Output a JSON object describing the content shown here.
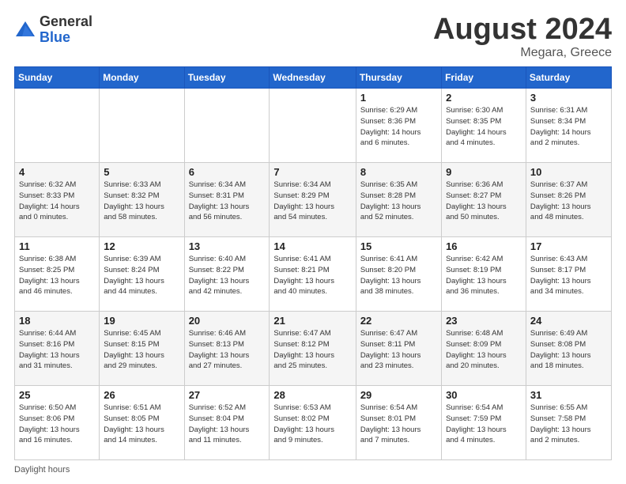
{
  "header": {
    "logo_general": "General",
    "logo_blue": "Blue",
    "title": "August 2024",
    "location": "Megara, Greece"
  },
  "days_of_week": [
    "Sunday",
    "Monday",
    "Tuesday",
    "Wednesday",
    "Thursday",
    "Friday",
    "Saturday"
  ],
  "weeks": [
    [
      {
        "day": "",
        "info": ""
      },
      {
        "day": "",
        "info": ""
      },
      {
        "day": "",
        "info": ""
      },
      {
        "day": "",
        "info": ""
      },
      {
        "day": "1",
        "info": "Sunrise: 6:29 AM\nSunset: 8:36 PM\nDaylight: 14 hours\nand 6 minutes."
      },
      {
        "day": "2",
        "info": "Sunrise: 6:30 AM\nSunset: 8:35 PM\nDaylight: 14 hours\nand 4 minutes."
      },
      {
        "day": "3",
        "info": "Sunrise: 6:31 AM\nSunset: 8:34 PM\nDaylight: 14 hours\nand 2 minutes."
      }
    ],
    [
      {
        "day": "4",
        "info": "Sunrise: 6:32 AM\nSunset: 8:33 PM\nDaylight: 14 hours\nand 0 minutes."
      },
      {
        "day": "5",
        "info": "Sunrise: 6:33 AM\nSunset: 8:32 PM\nDaylight: 13 hours\nand 58 minutes."
      },
      {
        "day": "6",
        "info": "Sunrise: 6:34 AM\nSunset: 8:31 PM\nDaylight: 13 hours\nand 56 minutes."
      },
      {
        "day": "7",
        "info": "Sunrise: 6:34 AM\nSunset: 8:29 PM\nDaylight: 13 hours\nand 54 minutes."
      },
      {
        "day": "8",
        "info": "Sunrise: 6:35 AM\nSunset: 8:28 PM\nDaylight: 13 hours\nand 52 minutes."
      },
      {
        "day": "9",
        "info": "Sunrise: 6:36 AM\nSunset: 8:27 PM\nDaylight: 13 hours\nand 50 minutes."
      },
      {
        "day": "10",
        "info": "Sunrise: 6:37 AM\nSunset: 8:26 PM\nDaylight: 13 hours\nand 48 minutes."
      }
    ],
    [
      {
        "day": "11",
        "info": "Sunrise: 6:38 AM\nSunset: 8:25 PM\nDaylight: 13 hours\nand 46 minutes."
      },
      {
        "day": "12",
        "info": "Sunrise: 6:39 AM\nSunset: 8:24 PM\nDaylight: 13 hours\nand 44 minutes."
      },
      {
        "day": "13",
        "info": "Sunrise: 6:40 AM\nSunset: 8:22 PM\nDaylight: 13 hours\nand 42 minutes."
      },
      {
        "day": "14",
        "info": "Sunrise: 6:41 AM\nSunset: 8:21 PM\nDaylight: 13 hours\nand 40 minutes."
      },
      {
        "day": "15",
        "info": "Sunrise: 6:41 AM\nSunset: 8:20 PM\nDaylight: 13 hours\nand 38 minutes."
      },
      {
        "day": "16",
        "info": "Sunrise: 6:42 AM\nSunset: 8:19 PM\nDaylight: 13 hours\nand 36 minutes."
      },
      {
        "day": "17",
        "info": "Sunrise: 6:43 AM\nSunset: 8:17 PM\nDaylight: 13 hours\nand 34 minutes."
      }
    ],
    [
      {
        "day": "18",
        "info": "Sunrise: 6:44 AM\nSunset: 8:16 PM\nDaylight: 13 hours\nand 31 minutes."
      },
      {
        "day": "19",
        "info": "Sunrise: 6:45 AM\nSunset: 8:15 PM\nDaylight: 13 hours\nand 29 minutes."
      },
      {
        "day": "20",
        "info": "Sunrise: 6:46 AM\nSunset: 8:13 PM\nDaylight: 13 hours\nand 27 minutes."
      },
      {
        "day": "21",
        "info": "Sunrise: 6:47 AM\nSunset: 8:12 PM\nDaylight: 13 hours\nand 25 minutes."
      },
      {
        "day": "22",
        "info": "Sunrise: 6:47 AM\nSunset: 8:11 PM\nDaylight: 13 hours\nand 23 minutes."
      },
      {
        "day": "23",
        "info": "Sunrise: 6:48 AM\nSunset: 8:09 PM\nDaylight: 13 hours\nand 20 minutes."
      },
      {
        "day": "24",
        "info": "Sunrise: 6:49 AM\nSunset: 8:08 PM\nDaylight: 13 hours\nand 18 minutes."
      }
    ],
    [
      {
        "day": "25",
        "info": "Sunrise: 6:50 AM\nSunset: 8:06 PM\nDaylight: 13 hours\nand 16 minutes."
      },
      {
        "day": "26",
        "info": "Sunrise: 6:51 AM\nSunset: 8:05 PM\nDaylight: 13 hours\nand 14 minutes."
      },
      {
        "day": "27",
        "info": "Sunrise: 6:52 AM\nSunset: 8:04 PM\nDaylight: 13 hours\nand 11 minutes."
      },
      {
        "day": "28",
        "info": "Sunrise: 6:53 AM\nSunset: 8:02 PM\nDaylight: 13 hours\nand 9 minutes."
      },
      {
        "day": "29",
        "info": "Sunrise: 6:54 AM\nSunset: 8:01 PM\nDaylight: 13 hours\nand 7 minutes."
      },
      {
        "day": "30",
        "info": "Sunrise: 6:54 AM\nSunset: 7:59 PM\nDaylight: 13 hours\nand 4 minutes."
      },
      {
        "day": "31",
        "info": "Sunrise: 6:55 AM\nSunset: 7:58 PM\nDaylight: 13 hours\nand 2 minutes."
      }
    ]
  ],
  "footer": {
    "daylight_label": "Daylight hours"
  }
}
